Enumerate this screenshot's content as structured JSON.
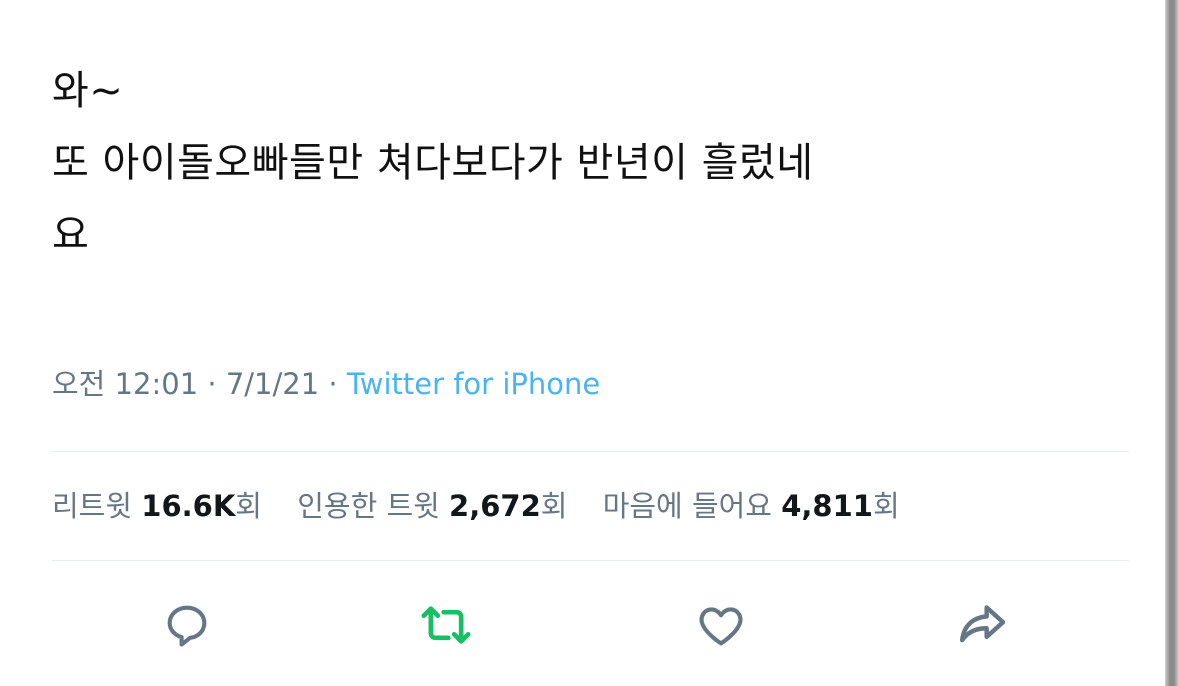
{
  "tweet": {
    "text": "와~\n또 아이돌오빠들만 쳐다보다가 반년이 흘렀네\n요"
  },
  "meta": {
    "time": "오전 12:01",
    "sep1": " · ",
    "date": "7/1/21",
    "sep2": " · ",
    "source": "Twitter for iPhone"
  },
  "stats": {
    "retweets_label": "리트윗",
    "retweets_value": "16.6K",
    "retweets_unit": "회",
    "quotes_label": "인용한 트윗",
    "quotes_value": "2,672",
    "quotes_unit": "회",
    "likes_label": "마음에 들어요",
    "likes_value": "4,811",
    "likes_unit": "회"
  },
  "actions": {
    "reply_icon": "reply-icon",
    "retweet_icon": "retweet-icon",
    "like_icon": "heart-icon",
    "share_icon": "share-icon",
    "icon_color": "#657786",
    "retweet_active_color": "#17bf63"
  }
}
